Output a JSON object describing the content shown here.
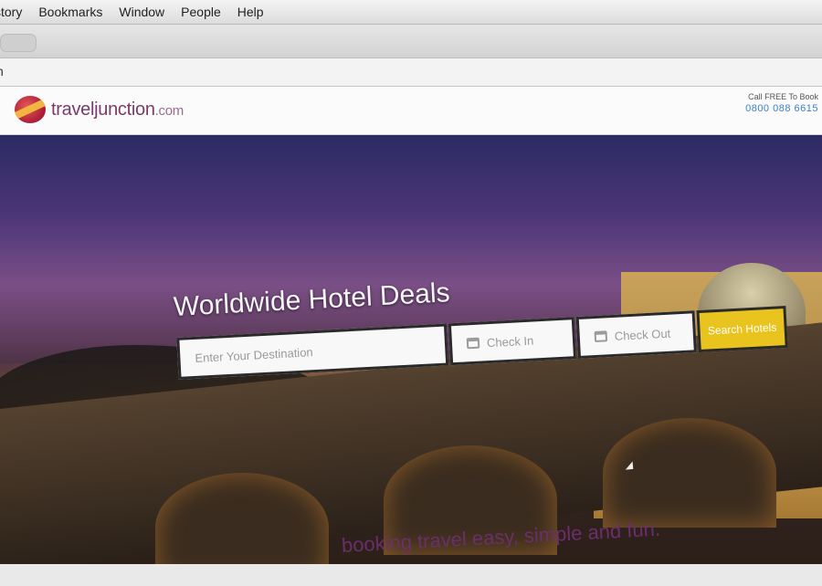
{
  "os_menu": [
    "story",
    "Bookmarks",
    "Window",
    "People",
    "Help"
  ],
  "address": {
    "text": "n"
  },
  "site": {
    "logo_name": "traveljunction",
    "logo_tld": ".com",
    "call_label": "Call FREE To Book",
    "call_number": "0800 088 6615"
  },
  "hero": {
    "headline": "Worldwide Hotel Deals",
    "destination_placeholder": "Enter Your Destination",
    "check_in_label": "Check In",
    "check_out_label": "Check Out",
    "search_button": "Search Hotels"
  },
  "tagline": "booking travel easy, simple and fun."
}
